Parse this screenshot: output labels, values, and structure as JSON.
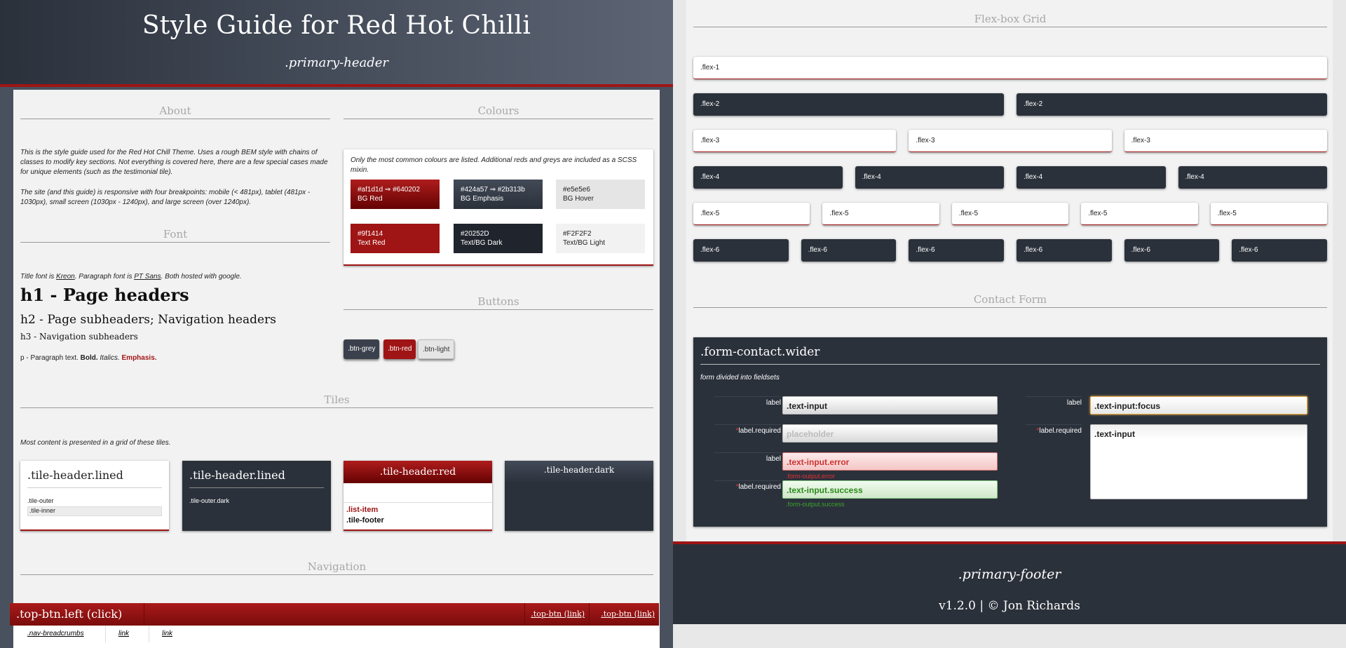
{
  "header": {
    "title": "Style Guide for Red Hot Chilli",
    "subtitle": ".primary-header"
  },
  "about": {
    "title": "About",
    "text1": "This is the style guide used for the Red Hot Chill Theme. Uses a rough BEM style with chains of classes to modify key sections. Not everything is covered here, there are a few special cases made for unique elements (such as the testimonial tile).",
    "text2": "The site (and this guide) is responsive with four breakpoints: mobile (< 481px), tablet (481px - 1030px), small screen (1030px - 1240px), and large screen (over 1240px)."
  },
  "colours": {
    "title": "Colours",
    "intro": "Only the most common colours are listed. Additional reds and greys are included as a SCSS mixin.",
    "swatches": [
      {
        "code": "#af1d1d ⇒ #640202",
        "name": "BG Red"
      },
      {
        "code": "#424a57 ⇒ #2b313b",
        "name": "BG Emphasis"
      },
      {
        "code": "#e5e5e6",
        "name": "BG Hover"
      },
      {
        "code": "#9f1414",
        "name": "Text Red"
      },
      {
        "code": "#20252D",
        "name": "Text/BG Dark"
      },
      {
        "code": "#F2F2F2",
        "name": "Text/BG Light"
      }
    ]
  },
  "font": {
    "title": "Font",
    "intro_pre": "Title font is ",
    "title_font": "Kreon",
    "intro_mid": ". Paragraph font is ",
    "para_font": "PT Sans",
    "intro_post": ". Both hosted with google.",
    "h1": "h1 - Page headers",
    "h2": "h2 - Page subheaders; Navigation headers",
    "h3": "h3 - Navigation subheaders",
    "p_pre": "p - Paragraph text. ",
    "p_bold": "Bold.",
    "p_italic": " Italics.",
    "p_emph": " Emphasis."
  },
  "buttons": {
    "title": "Buttons",
    "grey": ".btn-grey",
    "red": ".btn-red",
    "light": ".btn-light"
  },
  "tiles": {
    "title": "Tiles",
    "intro": "Most content is presented in a grid of these tiles.",
    "t1": {
      "header": ".tile-header.lined",
      "outer": ".tile-outer",
      "inner": ".tile-inner"
    },
    "t2": {
      "header": ".tile-header.lined",
      "outer": ".tile-outer.dark"
    },
    "t3": {
      "header": ".tile-header.red",
      "item": ".list-item",
      "footer": ".tile-footer"
    },
    "t4": {
      "header": ".tile-header.dark"
    }
  },
  "navigation": {
    "title": "Navigation",
    "left_btn": ".top-btn.left (click)",
    "link1": ".top-btn (link)",
    "link2": ".top-btn (link)",
    "crumbs": [
      ".nav-breadcrumbs",
      "link",
      "link"
    ]
  },
  "flex": {
    "title": "Flex-box Grid",
    "rows": [
      {
        "label": ".flex-1",
        "count": 1,
        "style": "light"
      },
      {
        "label": ".flex-2",
        "count": 2,
        "style": "dark"
      },
      {
        "label": ".flex-3",
        "count": 3,
        "style": "light"
      },
      {
        "label": ".flex-4",
        "count": 4,
        "style": "dark"
      },
      {
        "label": ".flex-5",
        "count": 5,
        "style": "light"
      },
      {
        "label": ".flex-6",
        "count": 6,
        "style": "dark"
      }
    ]
  },
  "contact": {
    "title": "Contact Form",
    "form_title": ".form-contact.wider",
    "form_intro": "form divided into fieldsets",
    "label": "label",
    "label_required": "label.required",
    "required_mark": "*",
    "input1": ".text-input",
    "placeholder": "placeholder",
    "input_error": ".text-input.error",
    "output_error": ".form-output.error",
    "input_success": ".text-input.success",
    "output_success": ".form-output.success",
    "input_focus": ".text-input:focus",
    "textarea": ".text-input"
  },
  "footer": {
    "subtitle": ".primary-footer",
    "version": "v1.2.0 | © Jon Richards"
  },
  "colors": {
    "red": "#9f1414",
    "dark": "#2b313b",
    "light": "#f2f2f2"
  }
}
